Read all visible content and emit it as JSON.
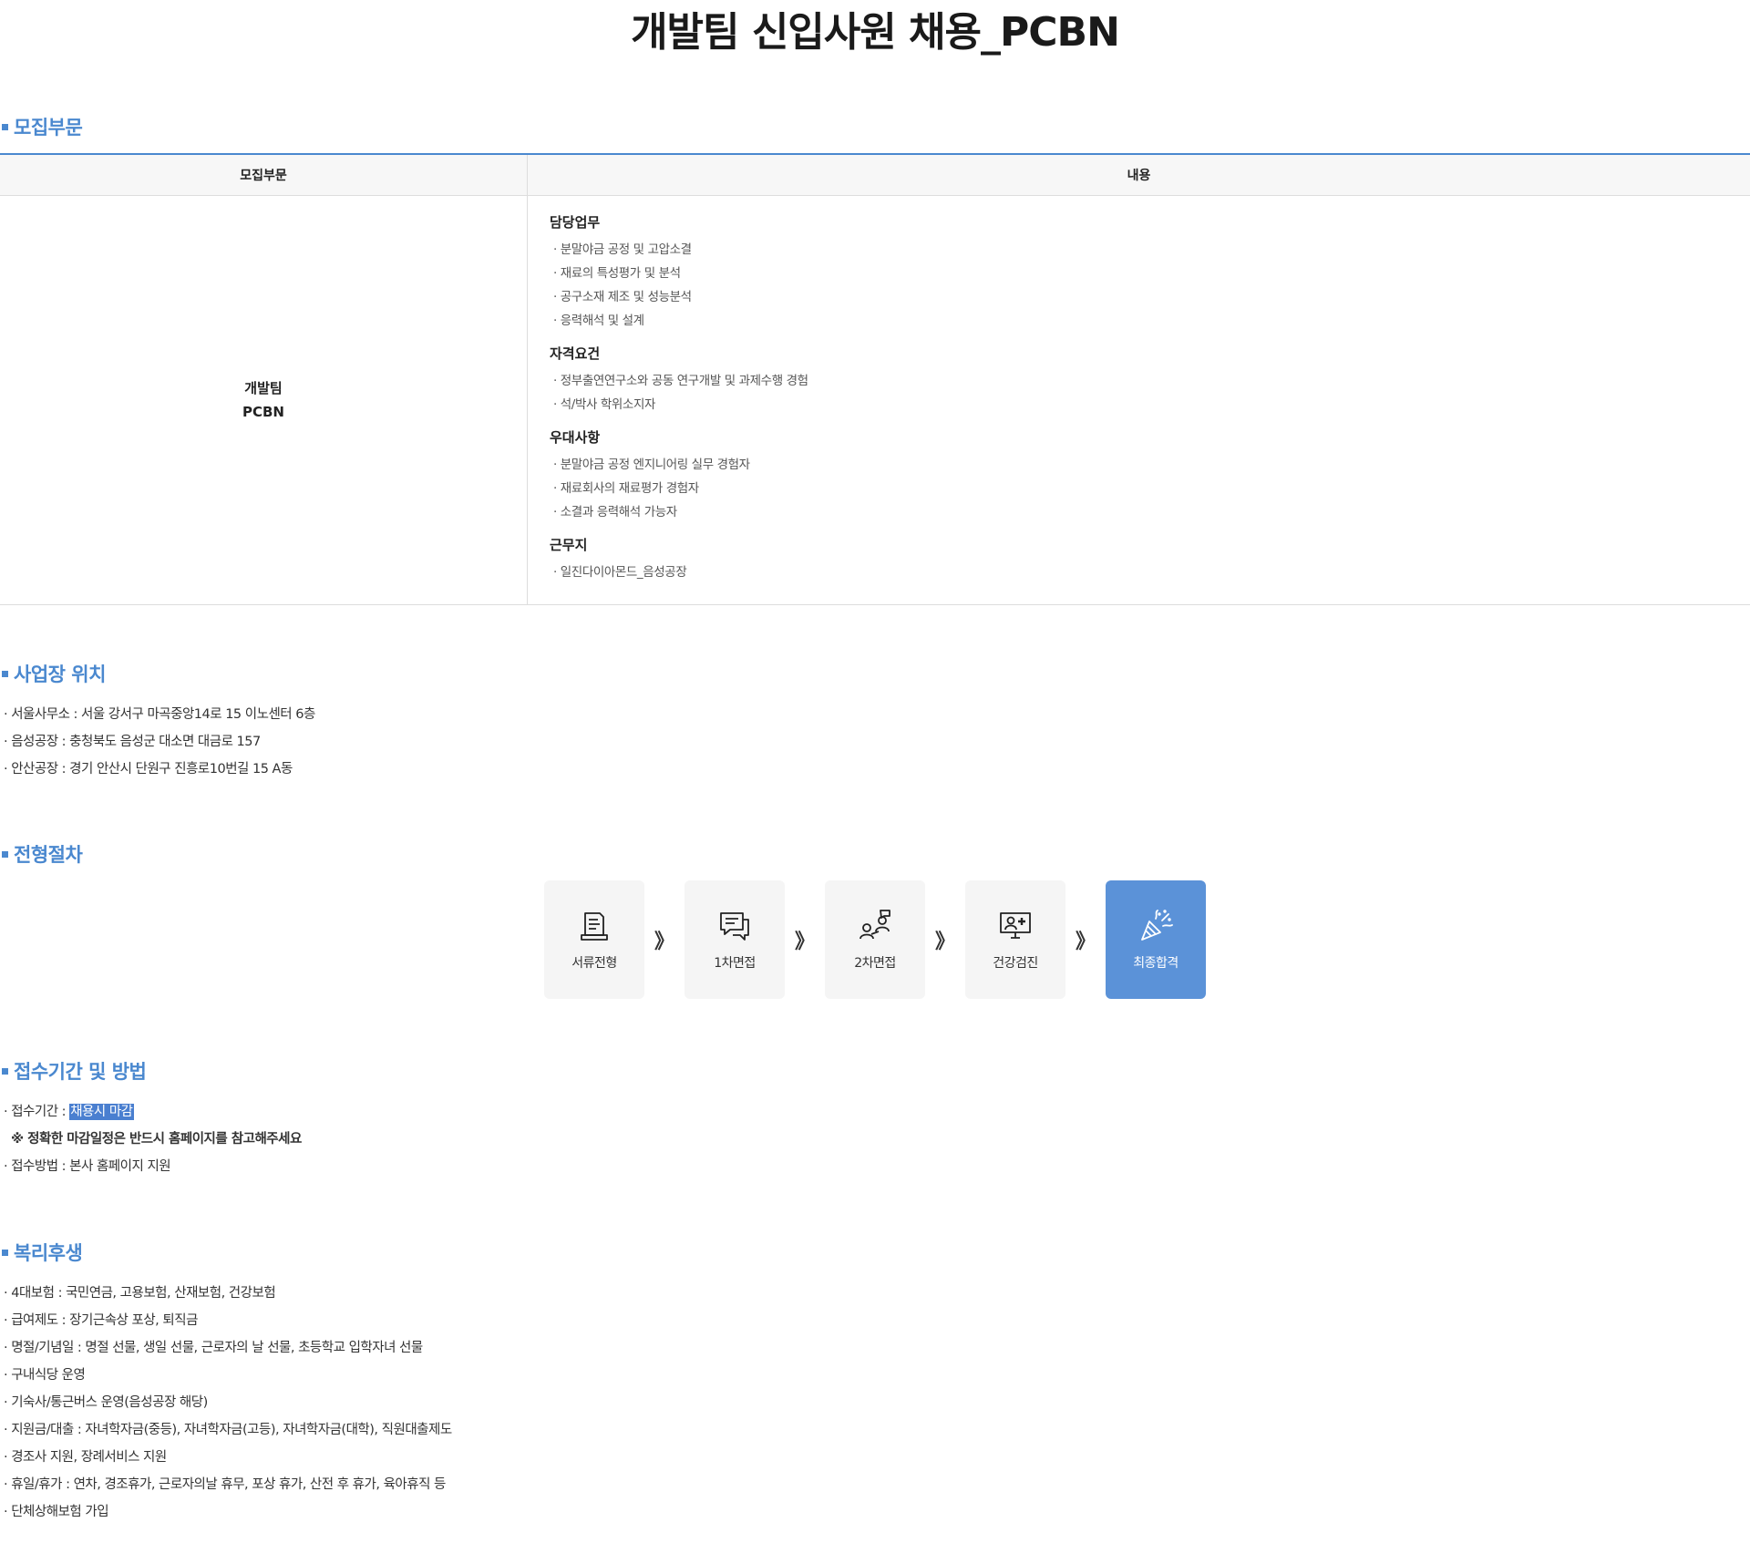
{
  "title": "개발팀 신입사원 채용_PCBN",
  "sections": {
    "recruit": "모집부문",
    "location": "사업장 위치",
    "process": "전형절차",
    "apply": "접수기간 및 방법",
    "welfare": "복리후생"
  },
  "table": {
    "headers": [
      "모집부문",
      "내용"
    ],
    "dept_line1": "개발팀",
    "dept_line2": "PCBN",
    "blocks": [
      {
        "title": "담당업무",
        "items": [
          "· 분말야금 공정 및 고압소결",
          "· 재료의 특성평가 및 분석",
          "· 공구소재 제조 및 성능분석",
          "· 응력해석 및 설계"
        ]
      },
      {
        "title": "자격요건",
        "items": [
          "· 정부출연연구소와 공동 연구개발 및 과제수행 경험",
          "· 석/박사 학위소지자"
        ]
      },
      {
        "title": "우대사항",
        "items": [
          "· 분말야금 공정 엔지니어링 실무 경험자",
          "· 재료회사의 재료평가 경험자",
          "· 소결과 응력해석 가능자"
        ]
      },
      {
        "title": "근무지",
        "items": [
          "· 일진다이아몬드_음성공장"
        ]
      }
    ]
  },
  "locations": [
    "· 서울사무소 : 서울 강서구 마곡중앙14로 15 이노센터 6층",
    "· 음성공장 : 충청북도 음성군 대소면 대금로 157",
    "· 안산공장 : 경기 안산시 단원구 진흥로10번길 15 A동"
  ],
  "process_steps": [
    {
      "label": "서류전형",
      "icon": "document-icon"
    },
    {
      "label": "1차면접",
      "icon": "chat-icon"
    },
    {
      "label": "2차면접",
      "icon": "interview-icon"
    },
    {
      "label": "건강검진",
      "icon": "medical-icon"
    },
    {
      "label": "최종합격",
      "icon": "party-popper-icon"
    }
  ],
  "process_arrow": "》",
  "apply": {
    "period_label": "· 접수기간 : ",
    "period_value": "채용시 마감",
    "note": "※ 정확한 마감일정은 반드시 홈페이지를 참고해주세요",
    "method": "· 접수방법 : 본사 홈페이지 지원"
  },
  "welfare": [
    "· 4대보험 : 국민연금, 고용보험, 산재보험, 건강보험",
    "· 급여제도 : 장기근속상 포상, 퇴직금",
    "· 명절/기념일 : 명절 선물, 생일 선물, 근로자의 날 선물, 초등학교 입학자녀 선물",
    "· 구내식당 운영",
    "· 기숙사/통근버스 운영(음성공장 해당)",
    "· 지원금/대출 : 자녀학자금(중등), 자녀학자금(고등), 자녀학자금(대학), 직원대출제도",
    "· 경조사 지원, 장례서비스 지원",
    "· 휴일/휴가 : 연차, 경조휴가, 근로자의날 휴무, 포상 휴가, 산전 후 휴가, 육아휴직 등",
    "· 단체상해보험 가입"
  ],
  "colors": {
    "accent": "#4a88cf",
    "final_step": "#5b92d8"
  }
}
